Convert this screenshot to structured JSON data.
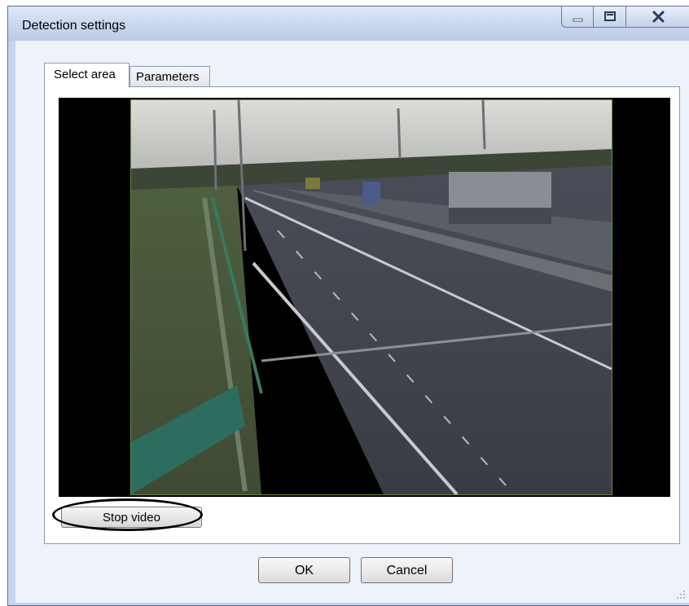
{
  "window": {
    "title": "Detection settings",
    "controls": {
      "minimize_icon": "minimize-icon",
      "maximize_icon": "maximize-icon",
      "close_icon": "close-icon"
    }
  },
  "tabs": [
    {
      "label": "Select area",
      "active": true
    },
    {
      "label": "Parameters",
      "active": false
    }
  ],
  "video": {
    "content": "camera-feed",
    "stop_label": "Stop video"
  },
  "buttons": {
    "ok": "OK",
    "cancel": "Cancel"
  },
  "colors": {
    "window_frame": "#c7d3ef",
    "client_bg": "#eef2fb",
    "highlight_ellipse": "#000000"
  }
}
